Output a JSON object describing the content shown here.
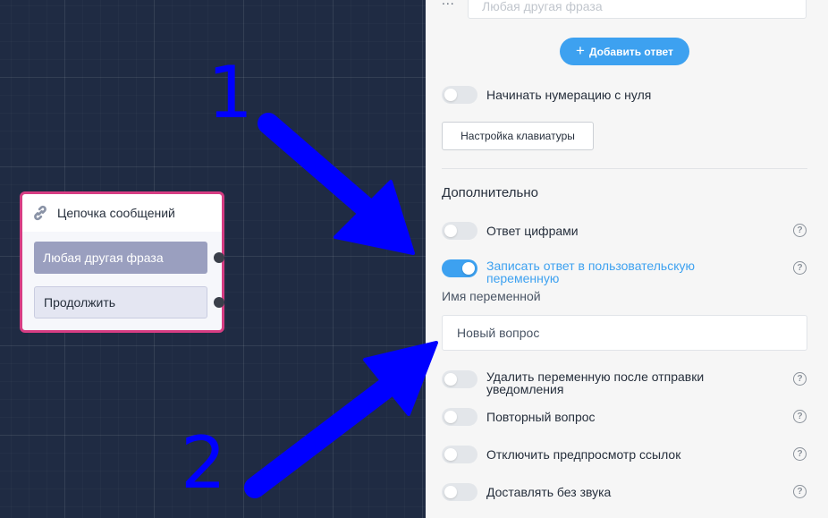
{
  "canvas": {
    "node": {
      "title": "Цепочка сообщений",
      "icon": "link-icon",
      "buttons": [
        "Любая другая фраза",
        "Продолжить"
      ]
    }
  },
  "panel": {
    "top_row": {
      "dots": "...",
      "placeholder": "Любая другая фраза"
    },
    "add_answer_label": "Добавить ответ",
    "numbering_toggle": {
      "label": "Начинать нумерацию с нуля",
      "on": false
    },
    "keyboard_button_label": "Настройка клавиатуры",
    "section_title": "Дополнительно",
    "options": [
      {
        "label": "Ответ цифрами",
        "on": false
      },
      {
        "label": "Записать ответ в пользовательскую переменную",
        "on": true
      },
      {
        "label": "Удалить переменную после отправки уведомления",
        "on": false
      },
      {
        "label": "Повторный вопрос",
        "on": false
      },
      {
        "label": "Отключить предпросмотр ссылок",
        "on": false
      },
      {
        "label": "Доставлять без звука",
        "on": false
      }
    ],
    "variable_label": "Имя переменной",
    "variable_value": "Новый вопрос",
    "help_glyph": "?"
  },
  "annotations": {
    "first": "1",
    "second": "2"
  },
  "colors": {
    "accent": "#3da1f0",
    "node_border": "#d63d83",
    "annotation": "#0000ff",
    "canvas": "#1f2b43"
  }
}
